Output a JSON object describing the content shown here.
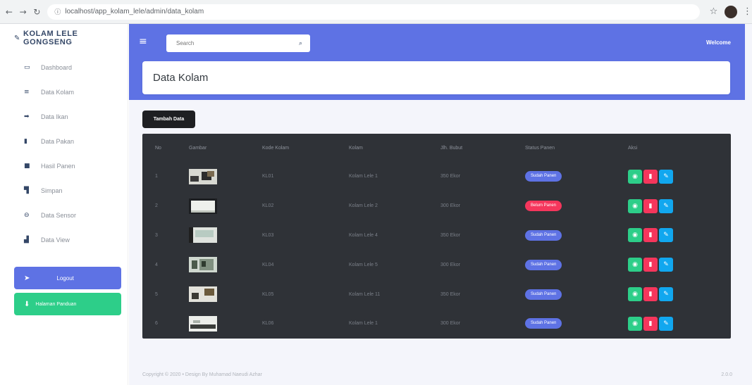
{
  "browser": {
    "url": "localhost/app_kolam_lele/admin/data_kolam",
    "back_icon": "arrow-left-icon",
    "forward_icon": "arrow-right-icon",
    "reload_icon": "reload-icon"
  },
  "brand": {
    "name": "KOLAM LELE GONGSENG"
  },
  "sidebar": {
    "items": [
      {
        "label": "Dashboard",
        "icon": "monitor-icon"
      },
      {
        "label": "Data Kolam",
        "icon": "list-icon"
      },
      {
        "label": "Data Ikan",
        "icon": "fish-icon"
      },
      {
        "label": "Data Pakan",
        "icon": "truck-icon"
      },
      {
        "label": "Hasil Panen",
        "icon": "clipboard-icon"
      },
      {
        "label": "Simpan",
        "icon": "bookmark-icon"
      },
      {
        "label": "Data Sensor",
        "icon": "lock-icon"
      },
      {
        "label": "Data View",
        "icon": "users-icon"
      }
    ],
    "logout_label": "Logout",
    "help_label": "Halaman Panduan"
  },
  "header": {
    "search_placeholder": "Search",
    "welcome": "Welcome",
    "page_title": "Data Kolam",
    "add_button": "Tambah Data"
  },
  "table": {
    "headers": [
      "No",
      "Gambar",
      "Kode Kolam",
      "Kolam",
      "Jlh. Bubut",
      "Status Panen",
      "Aksi"
    ],
    "rows": [
      {
        "no": "1",
        "kode": "KL01",
        "kolam": "Kolam Lele 1",
        "ikan": "350 Ekor",
        "status": "Sudah Panen",
        "status_type": "done"
      },
      {
        "no": "2",
        "kode": "KL02",
        "kolam": "Kolam Lele 2",
        "ikan": "300 Ekor",
        "status": "Belum Panen",
        "status_type": "pending"
      },
      {
        "no": "3",
        "kode": "KL03",
        "kolam": "Kolam Lele 4",
        "ikan": "350 Ekor",
        "status": "Sudah Panen",
        "status_type": "done"
      },
      {
        "no": "4",
        "kode": "KL04",
        "kolam": "Kolam Lele 5",
        "ikan": "300 Ekor",
        "status": "Sudah Panen",
        "status_type": "done"
      },
      {
        "no": "5",
        "kode": "KL05",
        "kolam": "Kolam Lele 11",
        "ikan": "350 Ekor",
        "status": "Sudah Panen",
        "status_type": "done"
      },
      {
        "no": "6",
        "kode": "KL06",
        "kolam": "Kolam Lele 1",
        "ikan": "300 Ekor",
        "status": "Sudah Panen",
        "status_type": "done"
      }
    ]
  },
  "footer": {
    "text": "Copyright © 2020 • Design By Muhamad Naeudi Azhar",
    "version": "2.0.0"
  },
  "colors": {
    "primary": "#5e72e4",
    "success": "#2dce89",
    "danger": "#f5365c",
    "info": "#11cdef"
  }
}
